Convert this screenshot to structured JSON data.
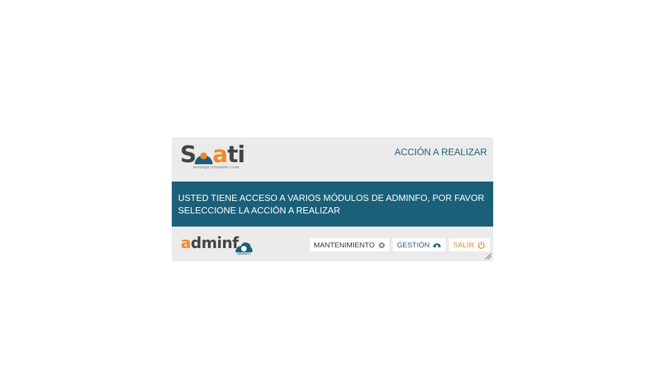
{
  "header": {
    "logo_text": "Solati",
    "logo_tagline": "tecnología | innovación | nube",
    "title": "ACCIÓN A REALIZAR"
  },
  "message": {
    "text": "USTED TIENE ACCESO A VARIOS MÓDULOS DE ADMINFO, POR FAVOR SELECCIONE LA ACCIÓN A REALIZAR"
  },
  "footer": {
    "logo_text": "adminfo",
    "logo_subtext": "SMART",
    "buttons": [
      {
        "label": "MANTENIMIENTO",
        "icon": "gear-icon"
      },
      {
        "label": "GESTIÓN",
        "icon": "cloud-icon"
      },
      {
        "label": "SALIR",
        "icon": "power-icon"
      }
    ]
  },
  "colors": {
    "brand_blue": "#1b6079",
    "brand_orange": "#ee8a2a",
    "dialog_bg": "#ebebeb"
  }
}
